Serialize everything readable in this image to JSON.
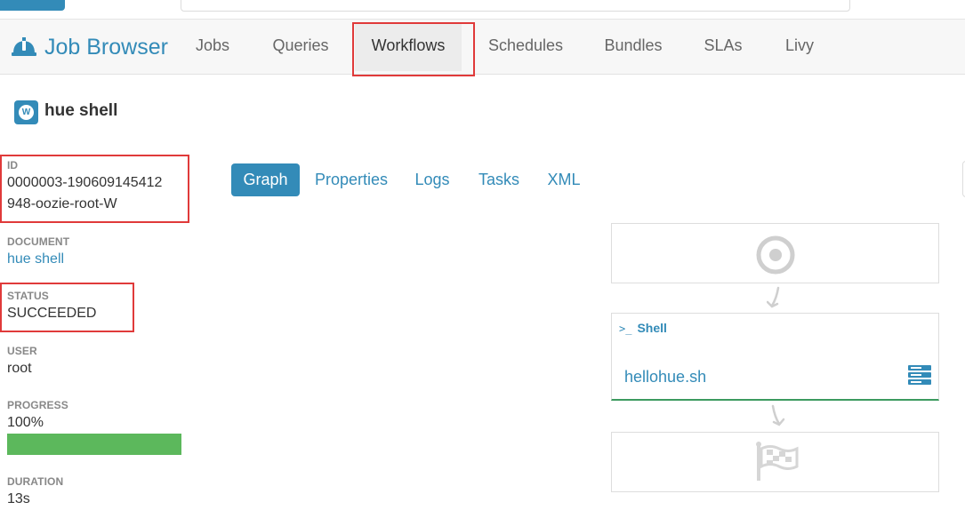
{
  "app": {
    "title": "Job Browser"
  },
  "nav": {
    "tabs": [
      "Jobs",
      "Queries",
      "Workflows",
      "Schedules",
      "Bundles",
      "SLAs",
      "Livy"
    ],
    "active": "Workflows"
  },
  "workflow": {
    "icon_letter": "W",
    "name": "hue shell",
    "id_label": "ID",
    "id_line1": "0000003-190609145412",
    "id_line2": "948-oozie-root-W",
    "document_label": "DOCUMENT",
    "document": "hue shell",
    "status_label": "STATUS",
    "status": "SUCCEEDED",
    "user_label": "USER",
    "user": "root",
    "progress_label": "PROGRESS",
    "progress_text": "100%",
    "progress": 1.0,
    "duration_label": "DURATION",
    "duration": "13s"
  },
  "detail_tabs": [
    "Graph",
    "Properties",
    "Logs",
    "Tasks",
    "XML"
  ],
  "graph": {
    "action_prompt": ">_",
    "action_type": "Shell",
    "action_file": "hellohue.sh"
  },
  "colors": {
    "accent": "#338bb8",
    "highlight": "#e03a3a",
    "progress": "#5cb85c",
    "success_border": "#3c9a5f"
  }
}
